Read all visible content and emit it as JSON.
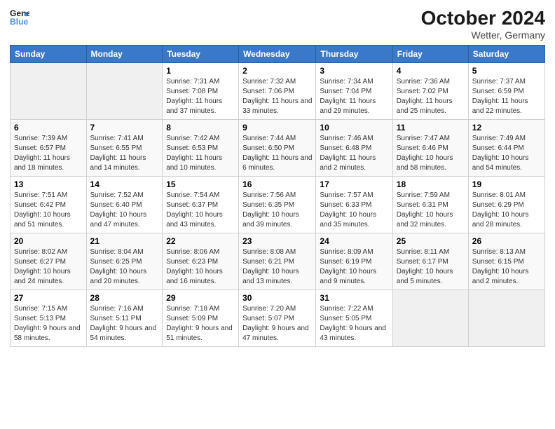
{
  "header": {
    "logo_line1": "General",
    "logo_line2": "Blue",
    "month_title": "October 2024",
    "location": "Wetter, Germany"
  },
  "days_of_week": [
    "Sunday",
    "Monday",
    "Tuesday",
    "Wednesday",
    "Thursday",
    "Friday",
    "Saturday"
  ],
  "weeks": [
    [
      {
        "day": "",
        "sunrise": "",
        "sunset": "",
        "daylight": ""
      },
      {
        "day": "",
        "sunrise": "",
        "sunset": "",
        "daylight": ""
      },
      {
        "day": "1",
        "sunrise": "Sunrise: 7:31 AM",
        "sunset": "Sunset: 7:08 PM",
        "daylight": "Daylight: 11 hours and 37 minutes."
      },
      {
        "day": "2",
        "sunrise": "Sunrise: 7:32 AM",
        "sunset": "Sunset: 7:06 PM",
        "daylight": "Daylight: 11 hours and 33 minutes."
      },
      {
        "day": "3",
        "sunrise": "Sunrise: 7:34 AM",
        "sunset": "Sunset: 7:04 PM",
        "daylight": "Daylight: 11 hours and 29 minutes."
      },
      {
        "day": "4",
        "sunrise": "Sunrise: 7:36 AM",
        "sunset": "Sunset: 7:02 PM",
        "daylight": "Daylight: 11 hours and 25 minutes."
      },
      {
        "day": "5",
        "sunrise": "Sunrise: 7:37 AM",
        "sunset": "Sunset: 6:59 PM",
        "daylight": "Daylight: 11 hours and 22 minutes."
      }
    ],
    [
      {
        "day": "6",
        "sunrise": "Sunrise: 7:39 AM",
        "sunset": "Sunset: 6:57 PM",
        "daylight": "Daylight: 11 hours and 18 minutes."
      },
      {
        "day": "7",
        "sunrise": "Sunrise: 7:41 AM",
        "sunset": "Sunset: 6:55 PM",
        "daylight": "Daylight: 11 hours and 14 minutes."
      },
      {
        "day": "8",
        "sunrise": "Sunrise: 7:42 AM",
        "sunset": "Sunset: 6:53 PM",
        "daylight": "Daylight: 11 hours and 10 minutes."
      },
      {
        "day": "9",
        "sunrise": "Sunrise: 7:44 AM",
        "sunset": "Sunset: 6:50 PM",
        "daylight": "Daylight: 11 hours and 6 minutes."
      },
      {
        "day": "10",
        "sunrise": "Sunrise: 7:46 AM",
        "sunset": "Sunset: 6:48 PM",
        "daylight": "Daylight: 11 hours and 2 minutes."
      },
      {
        "day": "11",
        "sunrise": "Sunrise: 7:47 AM",
        "sunset": "Sunset: 6:46 PM",
        "daylight": "Daylight: 10 hours and 58 minutes."
      },
      {
        "day": "12",
        "sunrise": "Sunrise: 7:49 AM",
        "sunset": "Sunset: 6:44 PM",
        "daylight": "Daylight: 10 hours and 54 minutes."
      }
    ],
    [
      {
        "day": "13",
        "sunrise": "Sunrise: 7:51 AM",
        "sunset": "Sunset: 6:42 PM",
        "daylight": "Daylight: 10 hours and 51 minutes."
      },
      {
        "day": "14",
        "sunrise": "Sunrise: 7:52 AM",
        "sunset": "Sunset: 6:40 PM",
        "daylight": "Daylight: 10 hours and 47 minutes."
      },
      {
        "day": "15",
        "sunrise": "Sunrise: 7:54 AM",
        "sunset": "Sunset: 6:37 PM",
        "daylight": "Daylight: 10 hours and 43 minutes."
      },
      {
        "day": "16",
        "sunrise": "Sunrise: 7:56 AM",
        "sunset": "Sunset: 6:35 PM",
        "daylight": "Daylight: 10 hours and 39 minutes."
      },
      {
        "day": "17",
        "sunrise": "Sunrise: 7:57 AM",
        "sunset": "Sunset: 6:33 PM",
        "daylight": "Daylight: 10 hours and 35 minutes."
      },
      {
        "day": "18",
        "sunrise": "Sunrise: 7:59 AM",
        "sunset": "Sunset: 6:31 PM",
        "daylight": "Daylight: 10 hours and 32 minutes."
      },
      {
        "day": "19",
        "sunrise": "Sunrise: 8:01 AM",
        "sunset": "Sunset: 6:29 PM",
        "daylight": "Daylight: 10 hours and 28 minutes."
      }
    ],
    [
      {
        "day": "20",
        "sunrise": "Sunrise: 8:02 AM",
        "sunset": "Sunset: 6:27 PM",
        "daylight": "Daylight: 10 hours and 24 minutes."
      },
      {
        "day": "21",
        "sunrise": "Sunrise: 8:04 AM",
        "sunset": "Sunset: 6:25 PM",
        "daylight": "Daylight: 10 hours and 20 minutes."
      },
      {
        "day": "22",
        "sunrise": "Sunrise: 8:06 AM",
        "sunset": "Sunset: 6:23 PM",
        "daylight": "Daylight: 10 hours and 16 minutes."
      },
      {
        "day": "23",
        "sunrise": "Sunrise: 8:08 AM",
        "sunset": "Sunset: 6:21 PM",
        "daylight": "Daylight: 10 hours and 13 minutes."
      },
      {
        "day": "24",
        "sunrise": "Sunrise: 8:09 AM",
        "sunset": "Sunset: 6:19 PM",
        "daylight": "Daylight: 10 hours and 9 minutes."
      },
      {
        "day": "25",
        "sunrise": "Sunrise: 8:11 AM",
        "sunset": "Sunset: 6:17 PM",
        "daylight": "Daylight: 10 hours and 5 minutes."
      },
      {
        "day": "26",
        "sunrise": "Sunrise: 8:13 AM",
        "sunset": "Sunset: 6:15 PM",
        "daylight": "Daylight: 10 hours and 2 minutes."
      }
    ],
    [
      {
        "day": "27",
        "sunrise": "Sunrise: 7:15 AM",
        "sunset": "Sunset: 5:13 PM",
        "daylight": "Daylight: 9 hours and 58 minutes."
      },
      {
        "day": "28",
        "sunrise": "Sunrise: 7:16 AM",
        "sunset": "Sunset: 5:11 PM",
        "daylight": "Daylight: 9 hours and 54 minutes."
      },
      {
        "day": "29",
        "sunrise": "Sunrise: 7:18 AM",
        "sunset": "Sunset: 5:09 PM",
        "daylight": "Daylight: 9 hours and 51 minutes."
      },
      {
        "day": "30",
        "sunrise": "Sunrise: 7:20 AM",
        "sunset": "Sunset: 5:07 PM",
        "daylight": "Daylight: 9 hours and 47 minutes."
      },
      {
        "day": "31",
        "sunrise": "Sunrise: 7:22 AM",
        "sunset": "Sunset: 5:05 PM",
        "daylight": "Daylight: 9 hours and 43 minutes."
      },
      {
        "day": "",
        "sunrise": "",
        "sunset": "",
        "daylight": ""
      },
      {
        "day": "",
        "sunrise": "",
        "sunset": "",
        "daylight": ""
      }
    ]
  ]
}
